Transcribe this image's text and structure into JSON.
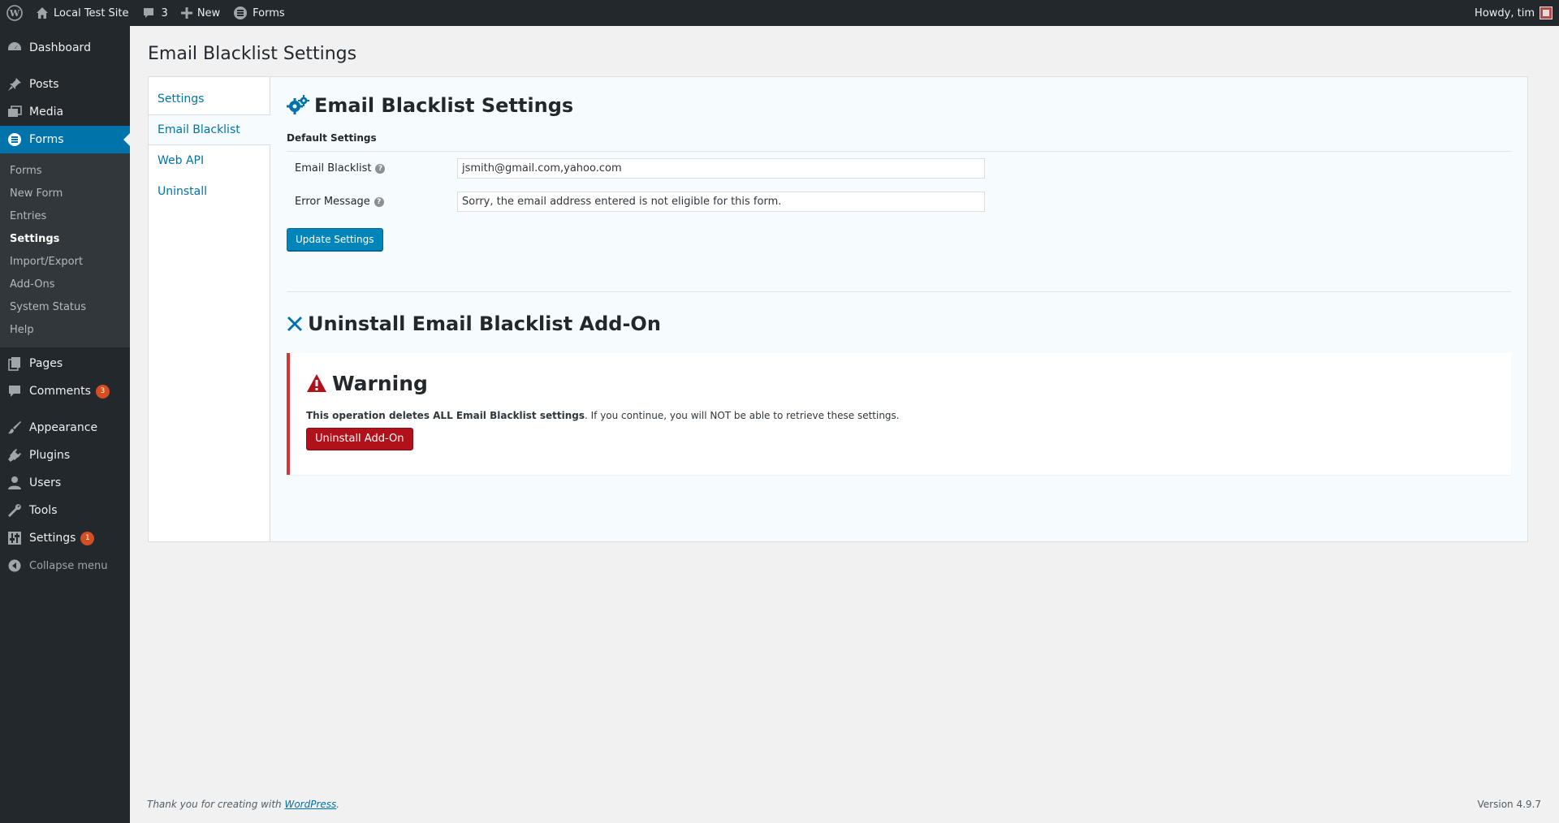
{
  "adminbar": {
    "site_name": "Local Test Site",
    "comments_count": "3",
    "new_label": "New",
    "forms_label": "Forms",
    "howdy": "Howdy, tim"
  },
  "sidebar": {
    "dashboard": "Dashboard",
    "posts": "Posts",
    "media": "Media",
    "forms": "Forms",
    "forms_submenu": [
      "Forms",
      "New Form",
      "Entries",
      "Settings",
      "Import/Export",
      "Add-Ons",
      "System Status",
      "Help"
    ],
    "pages": "Pages",
    "comments": "Comments",
    "comments_badge": "3",
    "appearance": "Appearance",
    "plugins": "Plugins",
    "users": "Users",
    "tools": "Tools",
    "settings": "Settings",
    "settings_badge": "1",
    "collapse": "Collapse menu"
  },
  "page": {
    "title": "Email Blacklist Settings",
    "nav_tabs": [
      "Settings",
      "Email Blacklist",
      "Web API",
      "Uninstall"
    ],
    "panel_title": "Email Blacklist Settings",
    "section_heading": "Default Settings",
    "fields": [
      {
        "label": "Email Blacklist",
        "value": "jsmith@gmail.com,yahoo.com"
      },
      {
        "label": "Error Message",
        "value": "Sorry, the email address entered is not eligible for this form."
      }
    ],
    "update_button": "Update Settings",
    "uninstall_title": "Uninstall Email Blacklist Add-On",
    "warning_title": "Warning",
    "warning_bold": "This operation deletes ALL Email Blacklist settings",
    "warning_rest": ". If you continue, you will NOT be able to retrieve these settings.",
    "uninstall_button": "Uninstall Add-On"
  },
  "footer": {
    "thanks_prefix": "Thank you for creating with ",
    "wp_link": "WordPress",
    "thanks_suffix": ".",
    "version": "Version 4.9.7"
  },
  "colors": {
    "accent": "#0073aa",
    "sidebar_bg": "#23282d",
    "danger": "#b0111a"
  }
}
